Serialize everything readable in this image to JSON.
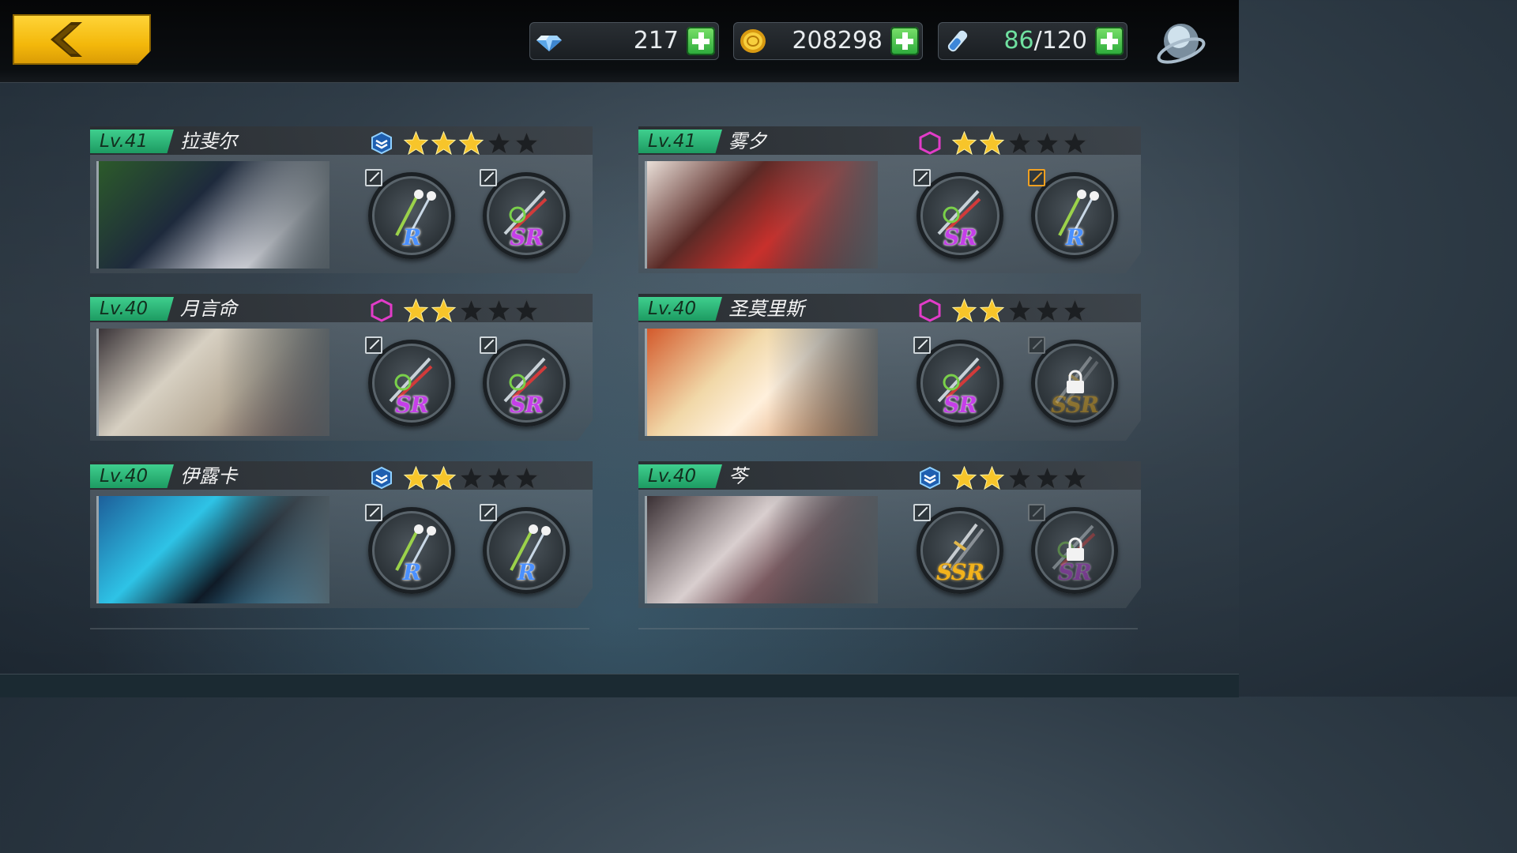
{
  "resources": {
    "diamonds": "217",
    "gold": "208298",
    "stamina_current": "86",
    "stamina_max": "/120"
  },
  "characters": [
    {
      "level": "Lv.41",
      "name": "拉斐尔",
      "rank_color": "#3e8fe6",
      "stars_filled": 3,
      "stars_total": 5,
      "weapons": [
        {
          "rarity": "R",
          "locked": false
        },
        {
          "rarity": "SR",
          "locked": false
        }
      ]
    },
    {
      "level": "Lv.41",
      "name": "雾夕",
      "rank_color": "#e23cc8",
      "stars_filled": 2,
      "stars_total": 5,
      "weapons": [
        {
          "rarity": "SR",
          "locked": false
        },
        {
          "rarity": "R",
          "locked": false
        }
      ]
    },
    {
      "level": "Lv.40",
      "name": "月言命",
      "rank_color": "#e23cc8",
      "stars_filled": 2,
      "stars_total": 5,
      "weapons": [
        {
          "rarity": "SR",
          "locked": false
        },
        {
          "rarity": "SR",
          "locked": false
        }
      ]
    },
    {
      "level": "Lv.40",
      "name": "圣莫里斯",
      "rank_color": "#e23cc8",
      "stars_filled": 2,
      "stars_total": 5,
      "weapons": [
        {
          "rarity": "SR",
          "locked": false
        },
        {
          "rarity": "SSR",
          "locked": true
        }
      ]
    },
    {
      "level": "Lv.40",
      "name": "伊露卡",
      "rank_color": "#3e8fe6",
      "stars_filled": 2,
      "stars_total": 5,
      "weapons": [
        {
          "rarity": "R",
          "locked": false
        },
        {
          "rarity": "R",
          "locked": false
        }
      ]
    },
    {
      "level": "Lv.40",
      "name": "芩",
      "rank_color": "#3e8fe6",
      "stars_filled": 2,
      "stars_total": 5,
      "weapons": [
        {
          "rarity": "SSR",
          "locked": false
        },
        {
          "rarity": "SR",
          "locked": true
        }
      ]
    }
  ],
  "icons": {
    "back": "back-arrow-icon",
    "diamond": "diamond-icon",
    "gold": "gold-coin-icon",
    "stamina": "stamina-vial-icon",
    "globe": "globe-icon"
  },
  "colors": {
    "accent_yellow": "#f3b80b",
    "level_green": "#2fb874",
    "add_green": "#2aa83a"
  }
}
